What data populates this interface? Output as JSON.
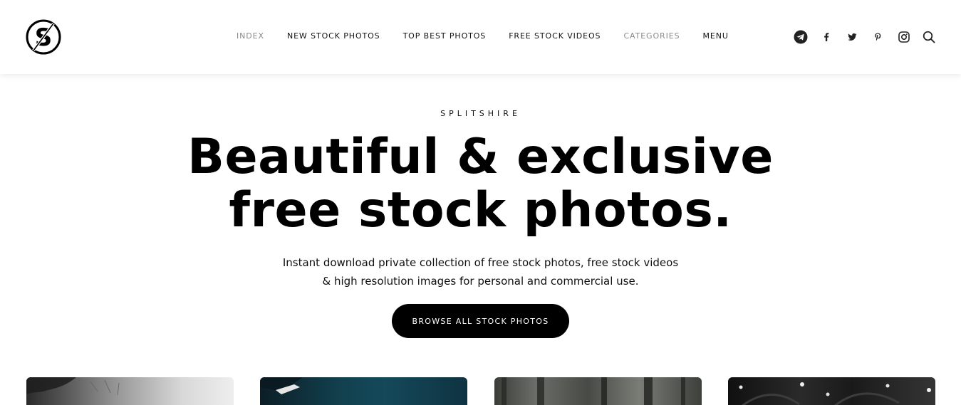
{
  "brand": {
    "logo_icon": "splitshire-s-logo-icon",
    "name": "SPLITSHIRE"
  },
  "nav": {
    "items": [
      {
        "label": "INDEX",
        "muted": true
      },
      {
        "label": "NEW STOCK PHOTOS",
        "muted": false
      },
      {
        "label": "TOP BEST PHOTOS",
        "muted": false
      },
      {
        "label": "FREE STOCK VIDEOS",
        "muted": false
      },
      {
        "label": "CATEGORIES",
        "muted": true
      },
      {
        "label": "MENU",
        "muted": false
      }
    ]
  },
  "social": [
    "telegram-icon",
    "facebook-icon",
    "twitter-icon",
    "pinterest-icon",
    "instagram-icon",
    "search-icon"
  ],
  "hero": {
    "eyebrow": "SPLITSHIRE",
    "headline_line1": "Beautiful & exclusive",
    "headline_line2": "free stock photos.",
    "sub_line1": "Instant download private collection of free stock photos, free stock videos",
    "sub_line2": "& high resolution images for personal and commercial use.",
    "cta_label": "BROWSE ALL STOCK PHOTOS"
  },
  "colors": {
    "text": "#000000",
    "muted_nav": "#8a8a8a",
    "button_bg": "#000000",
    "button_text": "#ffffff",
    "background": "#ffffff"
  }
}
